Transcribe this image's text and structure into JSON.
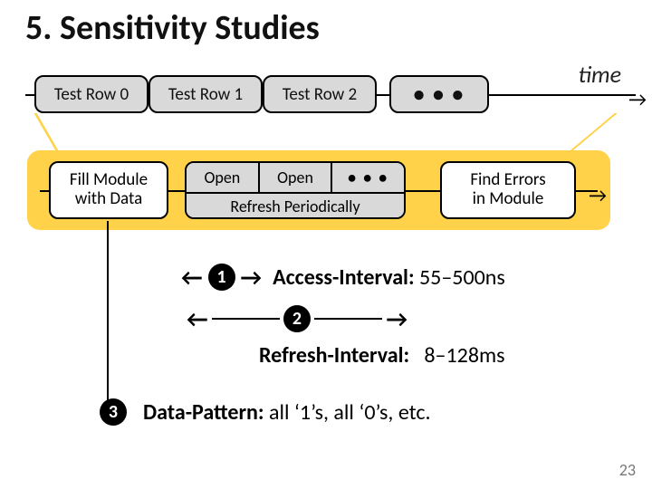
{
  "title": "5. Sensitivity Studies",
  "timeline": {
    "time_label": "time",
    "rows": [
      "Test Row 0",
      "Test Row 1",
      "Test Row 2"
    ],
    "ellipsis": "• • •"
  },
  "tray": {
    "fill_module": {
      "line1": "Fill Module",
      "line2": "with Data"
    },
    "open": {
      "label": "Open",
      "ellipsis": "• • •",
      "refresh": "Refresh Periodically"
    },
    "find_errors": {
      "line1": "Find Errors",
      "line2": "in Module"
    }
  },
  "params": {
    "p1": {
      "num": "1",
      "label": "Access-Interval:",
      "value": "55–500ns"
    },
    "p2": {
      "num": "2",
      "label": "Refresh-Interval:",
      "value": "8–128ms"
    },
    "p3": {
      "num": "3",
      "label": "Data-Pattern:",
      "value": "all ‘1’s, all ‘0’s, etc."
    }
  },
  "page": "23"
}
